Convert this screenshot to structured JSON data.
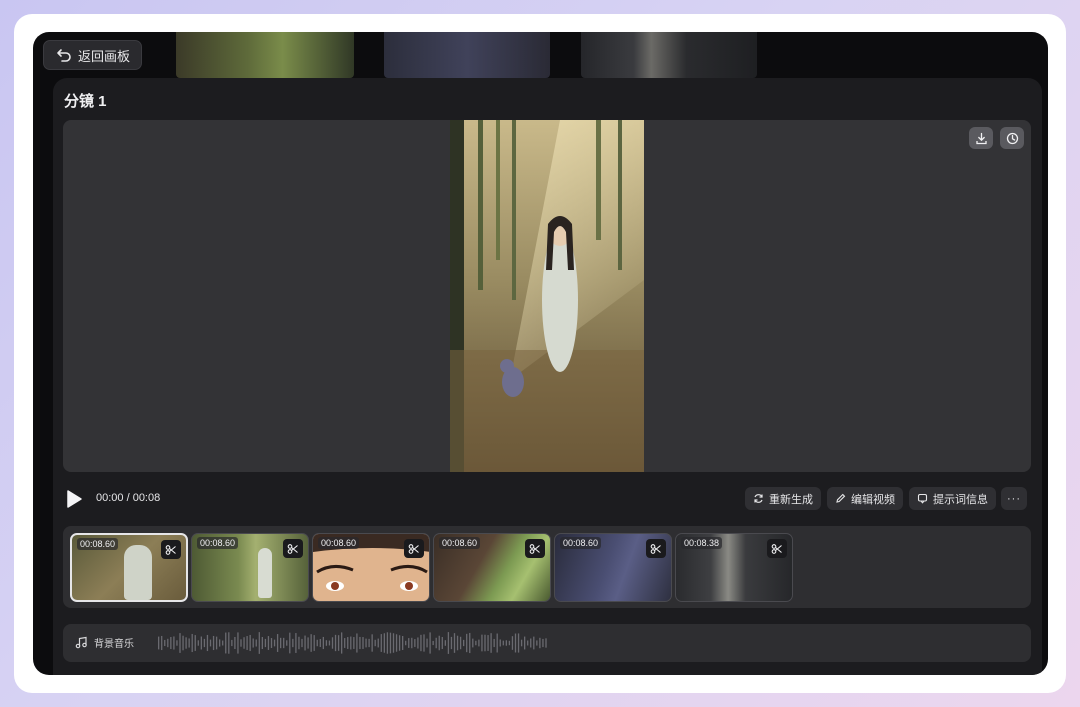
{
  "toolbar": {
    "back_label": "返回画板"
  },
  "panel": {
    "title": "分镜 1"
  },
  "player": {
    "timecode": "00:00 / 00:08"
  },
  "actions": {
    "regenerate": "重新生成",
    "edit_video": "编辑视频",
    "prompt_info": "提示词信息",
    "more": "···"
  },
  "clips": [
    {
      "duration": "00:08.60",
      "active": true
    },
    {
      "duration": "00:08.60",
      "active": false
    },
    {
      "duration": "00:08.60",
      "active": false
    },
    {
      "duration": "00:08.60",
      "active": false
    },
    {
      "duration": "00:08.60",
      "active": false
    },
    {
      "duration": "00:08.38",
      "active": false
    }
  ],
  "music": {
    "label": "背景音乐"
  },
  "colors": {
    "panel": "#1c1c1f",
    "viewer": "#333336",
    "accent": "#e6e6e8"
  },
  "icons": [
    "back-arrow-icon",
    "download-icon",
    "history-clock-icon",
    "play-icon",
    "refresh-icon",
    "pencil-icon",
    "prompt-info-icon",
    "more-icon",
    "scissors-icon",
    "music-note-icon"
  ]
}
